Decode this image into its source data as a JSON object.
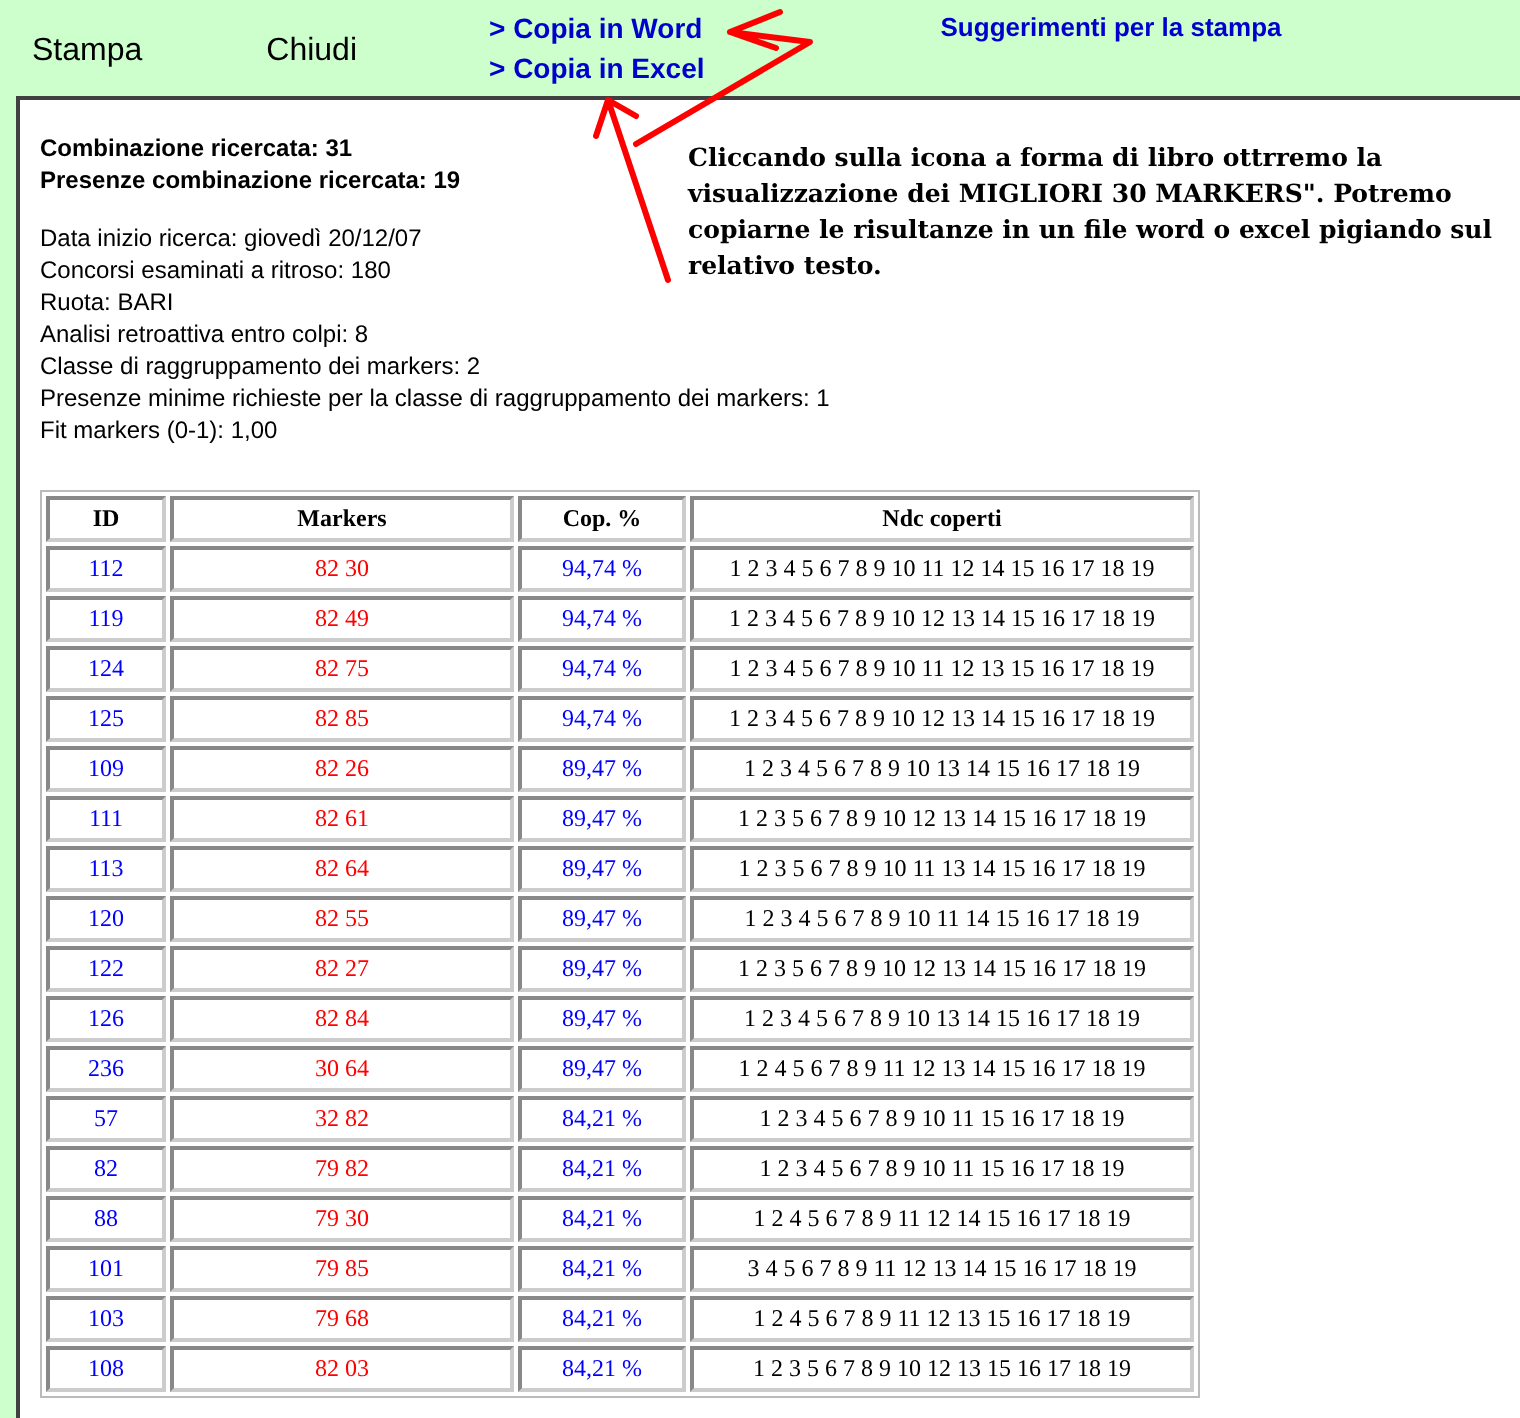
{
  "toolbar": {
    "buttons": [
      "Stampa",
      "Chiudi"
    ],
    "copy_links": [
      "> Copia in Word",
      "> Copia in Excel"
    ],
    "tips_link": "Suggerimenti per la stampa"
  },
  "summary": [
    "Combinazione ricercata: 31",
    "Presenze combinazione ricercata: 19"
  ],
  "details": [
    "Data inizio ricerca: giovedì 20/12/07",
    "Concorsi esaminati a ritroso: 180",
    "Ruota: BARI",
    "Analisi retroattiva entro colpi: 8",
    "Classe di raggruppamento dei markers: 2",
    "Presenze minime richieste per la classe di raggruppamento dei markers: 1",
    "Fit markers (0-1): 1,00"
  ],
  "note": "Cliccando sulla icona a forma di libro ottrremo la visualizzazione dei MIGLIORI 30 MARKERS\". Potremo copiarne le risultanze in un file word o excel pigiando sul relativo testo.",
  "table": {
    "columns": [
      "ID",
      "Markers",
      "Cop. %",
      "Ndc coperti"
    ],
    "rows": [
      [
        "112",
        "82 30",
        "94,74 %",
        "1 2 3 4 5 6 7 8 9 10 11 12 14 15 16 17 18 19"
      ],
      [
        "119",
        "82 49",
        "94,74 %",
        "1 2 3 4 5 6 7 8 9 10 12 13 14 15 16 17 18 19"
      ],
      [
        "124",
        "82 75",
        "94,74 %",
        "1 2 3 4 5 6 7 8 9 10 11 12 13 15 16 17 18 19"
      ],
      [
        "125",
        "82 85",
        "94,74 %",
        "1 2 3 4 5 6 7 8 9 10 12 13 14 15 16 17 18 19"
      ],
      [
        "109",
        "82 26",
        "89,47 %",
        "1 2 3 4 5 6 7 8 9 10 13 14 15 16 17 18 19"
      ],
      [
        "111",
        "82 61",
        "89,47 %",
        "1 2 3 5 6 7 8 9 10 12 13 14 15 16 17 18 19"
      ],
      [
        "113",
        "82 64",
        "89,47 %",
        "1 2 3 5 6 7 8 9 10 11 13 14 15 16 17 18 19"
      ],
      [
        "120",
        "82 55",
        "89,47 %",
        "1 2 3 4 5 6 7 8 9 10 11 14 15 16 17 18 19"
      ],
      [
        "122",
        "82 27",
        "89,47 %",
        "1 2 3 5 6 7 8 9 10 12 13 14 15 16 17 18 19"
      ],
      [
        "126",
        "82 84",
        "89,47 %",
        "1 2 3 4 5 6 7 8 9 10 13 14 15 16 17 18 19"
      ],
      [
        "236",
        "30 64",
        "89,47 %",
        "1 2 4 5 6 7 8 9 11 12 13 14 15 16 17 18 19"
      ],
      [
        "57",
        "32 82",
        "84,21 %",
        "1 2 3 4 5 6 7 8 9 10 11 15 16 17 18 19"
      ],
      [
        "82",
        "79 82",
        "84,21 %",
        "1 2 3 4 5 6 7 8 9 10 11 15 16 17 18 19"
      ],
      [
        "88",
        "79 30",
        "84,21 %",
        "1 2 4 5 6 7 8 9 11 12 14 15 16 17 18 19"
      ],
      [
        "101",
        "79 85",
        "84,21 %",
        "3 4 5 6 7 8 9 11 12 13 14 15 16 17 18 19"
      ],
      [
        "103",
        "79 68",
        "84,21 %",
        "1 2 4 5 6 7 8 9 11 12 13 15 16 17 18 19"
      ],
      [
        "108",
        "82 03",
        "84,21 %",
        "1 2 3 5 6 7 8 9 10 12 13 15 16 17 18 19"
      ]
    ]
  }
}
